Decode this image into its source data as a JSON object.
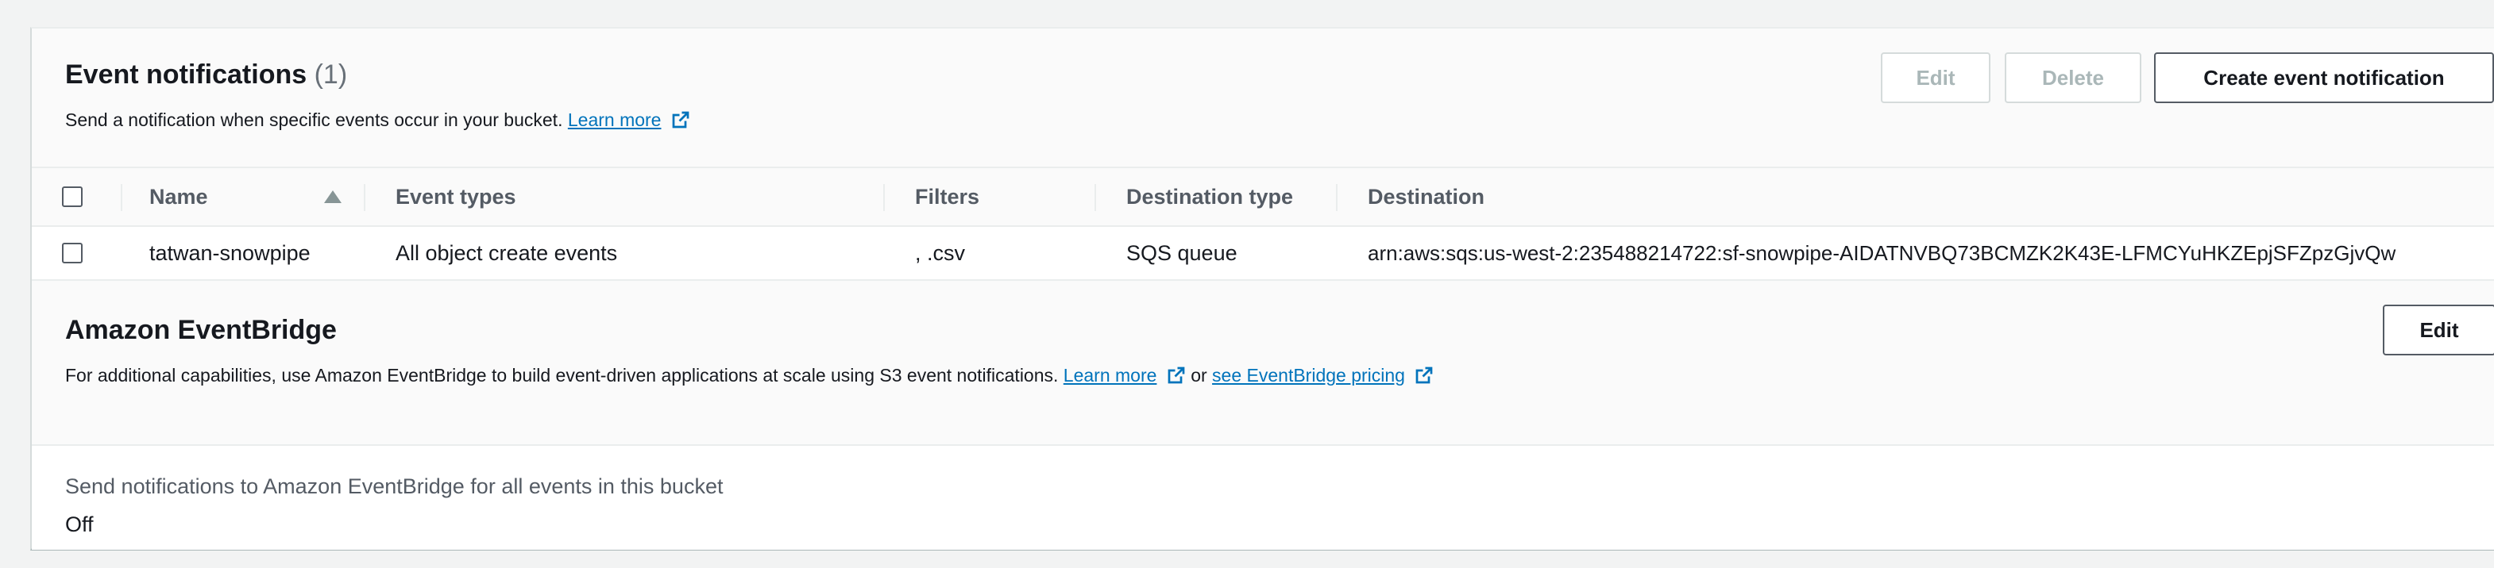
{
  "event_notifications": {
    "title": "Event notifications",
    "count": "(1)",
    "description": "Send a notification when specific events occur in your bucket.",
    "learn_more": "Learn more",
    "buttons": {
      "edit": "Edit",
      "delete": "Delete",
      "create": "Create event notification"
    },
    "table": {
      "columns": [
        "Name",
        "Event types",
        "Filters",
        "Destination type",
        "Destination"
      ],
      "rows": [
        {
          "name": "tatwan-snowpipe",
          "event_types": "All object create events",
          "filters": ", .csv",
          "destination_type": "SQS queue",
          "destination": "arn:aws:sqs:us-west-2:235488214722:sf-snowpipe-AIDATNVBQ73BCMZK2K43E-LFMCYuHKZEpjSFZpzGjvQw"
        }
      ]
    }
  },
  "eventbridge": {
    "title": "Amazon EventBridge",
    "edit": "Edit",
    "description": "For additional capabilities, use Amazon EventBridge to build event-driven applications at scale using S3 event notifications.",
    "learn_more": "Learn more",
    "or": "or",
    "pricing_link": "see EventBridge pricing",
    "setting_label": "Send notifications to Amazon EventBridge for all events in this bucket",
    "setting_value": "Off"
  },
  "colors": {
    "link": "#0073bb",
    "text": "#16191f",
    "muted": "#545b64",
    "disabled": "#aab7b8"
  }
}
